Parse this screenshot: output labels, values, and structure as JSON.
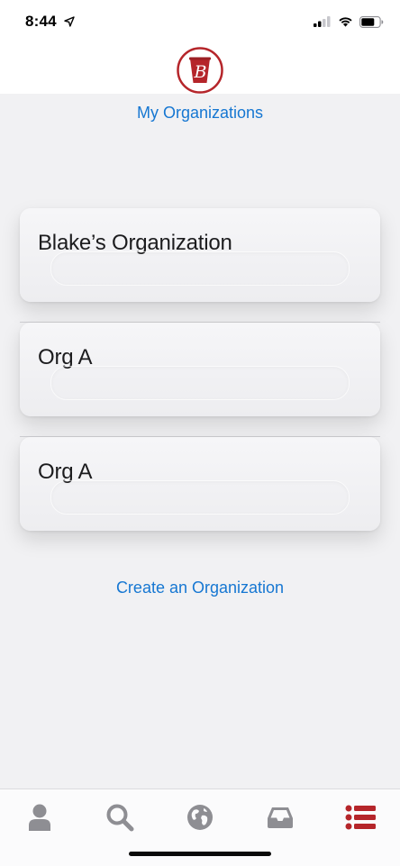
{
  "status_bar": {
    "time": "8:44"
  },
  "header": {
    "logo_letter": "B",
    "title": "My Organizations"
  },
  "organizations": [
    {
      "name": "Blake’s Organization"
    },
    {
      "name": "Org A"
    },
    {
      "name": "Org A"
    }
  ],
  "actions": {
    "create_label": "Create an Organization"
  },
  "tab_bar": {
    "tabs": [
      {
        "icon": "person-icon",
        "active": false
      },
      {
        "icon": "search-icon",
        "active": false
      },
      {
        "icon": "globe-icon",
        "active": false
      },
      {
        "icon": "inbox-icon",
        "active": false
      },
      {
        "icon": "list-icon",
        "active": true
      }
    ]
  },
  "colors": {
    "accent_blue": "#1677d2",
    "brand_red": "#b5252a",
    "tab_inactive": "#8e8e93",
    "background": "#f1f1f3"
  }
}
